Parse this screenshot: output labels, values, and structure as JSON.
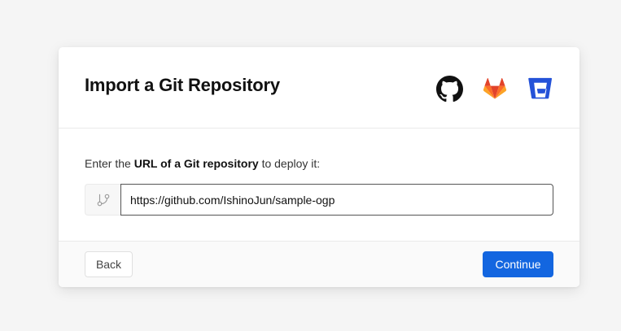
{
  "dialog": {
    "title": "Import a Git Repository",
    "providers": [
      {
        "name": "GitHub",
        "icon": "github-icon",
        "color": "#111111"
      },
      {
        "name": "GitLab",
        "icon": "gitlab-icon",
        "color": "#e24329"
      },
      {
        "name": "Bitbucket",
        "icon": "bitbucket-icon",
        "color": "#2452d8"
      }
    ]
  },
  "form": {
    "prompt_prefix": "Enter the ",
    "prompt_bold": "URL of a Git repository",
    "prompt_suffix": " to deploy it:",
    "prefix_icon": "git-branch-icon",
    "url_value": "https://github.com/IshinoJun/sample-ogp"
  },
  "footer": {
    "back_label": "Back",
    "continue_label": "Continue",
    "accent_color": "#1366e0"
  }
}
